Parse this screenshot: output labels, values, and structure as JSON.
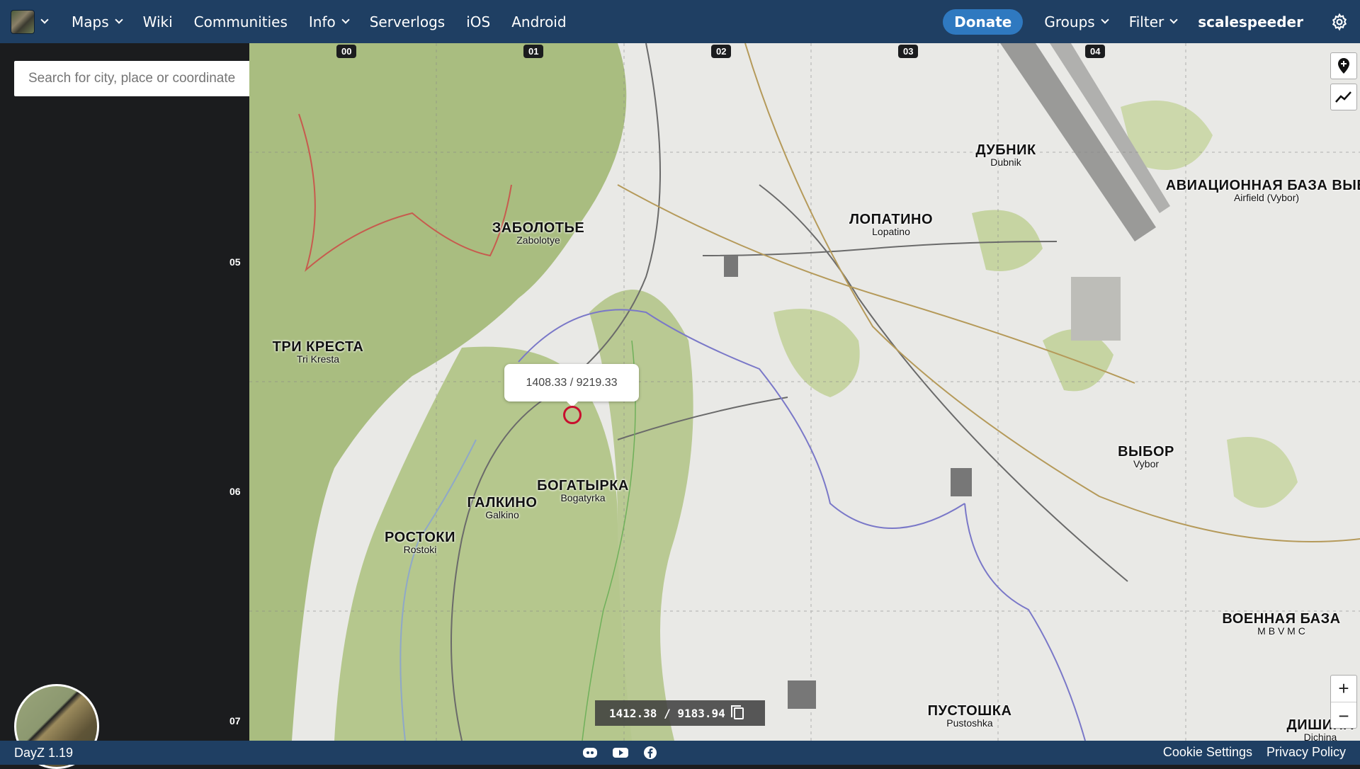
{
  "nav": {
    "menu_items": [
      {
        "label": "Maps",
        "dropdown": true
      },
      {
        "label": "Wiki",
        "dropdown": false
      },
      {
        "label": "Communities",
        "dropdown": false
      },
      {
        "label": "Info",
        "dropdown": true
      },
      {
        "label": "Serverlogs",
        "dropdown": false
      },
      {
        "label": "iOS",
        "dropdown": false
      },
      {
        "label": "Android",
        "dropdown": false
      }
    ],
    "donate": "Donate",
    "groups": "Groups",
    "filter": "Filter",
    "username": "scalespeeder"
  },
  "search": {
    "placeholder": "Search for city, place or coordinate"
  },
  "grid": {
    "columns": [
      "00",
      "01",
      "02",
      "03",
      "04"
    ],
    "rows": [
      "05",
      "06",
      "07"
    ]
  },
  "towns": [
    {
      "ru": "ДУБНИК",
      "en": "Dubnik"
    },
    {
      "ru": "АВИАЦИОННАЯ БАЗА ВЫБ",
      "en": "Airfield (Vybor)"
    },
    {
      "ru": "ЛОПАТИНО",
      "en": "Lopatino"
    },
    {
      "ru": "ЗАБОЛОТЬЕ",
      "en": "Zabolotye"
    },
    {
      "ru": "ТРИ КРЕСТА",
      "en": "Tri Kresta"
    },
    {
      "ru": "ВЫБОР",
      "en": "Vybor"
    },
    {
      "ru": "БОГАТЫРКА",
      "en": "Bogatyrka"
    },
    {
      "ru": "ГАЛКИНО",
      "en": "Galkino"
    },
    {
      "ru": "РОСТОКИ",
      "en": "Rostoki"
    },
    {
      "ru": "ВОЕННАЯ БАЗА",
      "en": "M B V M C"
    },
    {
      "ru": "ПУСТОШКА",
      "en": "Pustoshka"
    },
    {
      "ru": "ДИШИНА",
      "en": "Dichina"
    }
  ],
  "popup": {
    "coords": "1408.33 / 9219.33"
  },
  "cursor_coords": "1412.38 / 9183.94",
  "footer": {
    "version": "DayZ 1.19",
    "cookie": "Cookie Settings",
    "privacy": "Privacy Policy",
    "social_icons": [
      "discord-icon",
      "youtube-icon",
      "facebook-icon"
    ]
  },
  "colors": {
    "nav_bg": "#1f3f63",
    "donate_bg": "#2f79c0",
    "marker": "#c8102e"
  }
}
